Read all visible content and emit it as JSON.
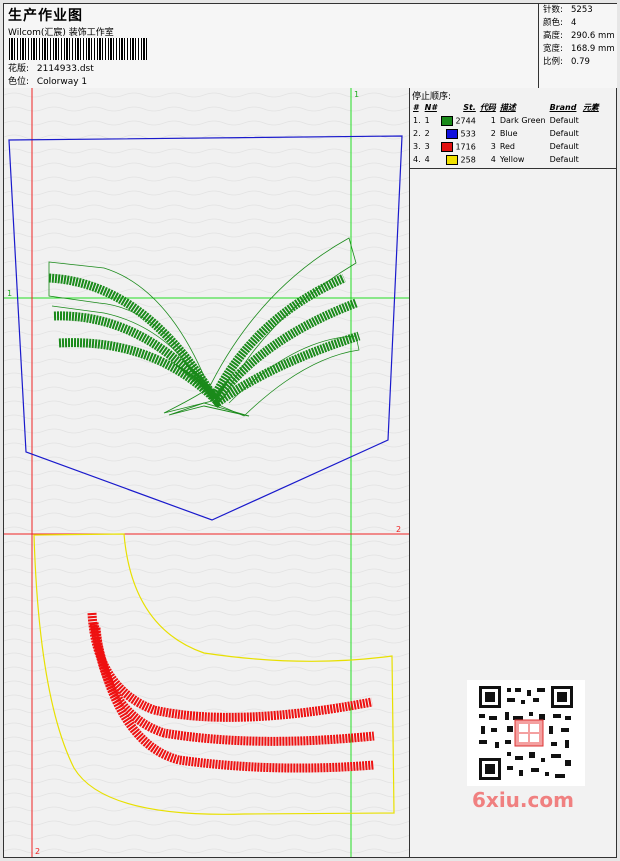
{
  "header": {
    "title": "生产作业图",
    "company": "Wilcom(汇宸) 装饰工作室",
    "design_label": "花版:",
    "design_value": "2114933.dst",
    "colorway_label": "色位:",
    "colorway_value": "Colorway 1"
  },
  "stats": [
    {
      "label": "针数:",
      "value": "5253"
    },
    {
      "label": "颜色:",
      "value": "4"
    },
    {
      "label": "高度:",
      "value": "290.6 mm"
    },
    {
      "label": "宽度:",
      "value": "168.9 mm"
    },
    {
      "label": "比例:",
      "value": "0.79"
    }
  ],
  "stop_sequence": {
    "title": "停止顺序:",
    "columns": [
      "#",
      "N#",
      "St.",
      "代码",
      "描述",
      "Brand",
      "元素"
    ],
    "rows": [
      {
        "index": "1.",
        "n": "1",
        "color": "#1a8a1a",
        "stitches": "2744",
        "code": "1",
        "desc": "Dark Green",
        "brand": "Default"
      },
      {
        "index": "2.",
        "n": "2",
        "color": "#1010dd",
        "stitches": "533",
        "code": "2",
        "desc": "Blue",
        "brand": "Default"
      },
      {
        "index": "3.",
        "n": "3",
        "color": "#e01010",
        "stitches": "1716",
        "code": "3",
        "desc": "Red",
        "brand": "Default"
      },
      {
        "index": "4.",
        "n": "4",
        "color": "#f0e000",
        "stitches": "258",
        "code": "4",
        "desc": "Yellow",
        "brand": "Default"
      }
    ]
  },
  "guides": {
    "vertical_1": "1",
    "horizontal_1": "1",
    "horizontal_2": "2",
    "vertical_2": "2"
  },
  "watermark": "6xiu.com",
  "colors": {
    "green": "#1a8a1a",
    "blue": "#1a1acc",
    "red": "#ee1111",
    "yellow": "#e8e000",
    "guide_green": "#22dd22",
    "guide_red": "#ee2222"
  }
}
